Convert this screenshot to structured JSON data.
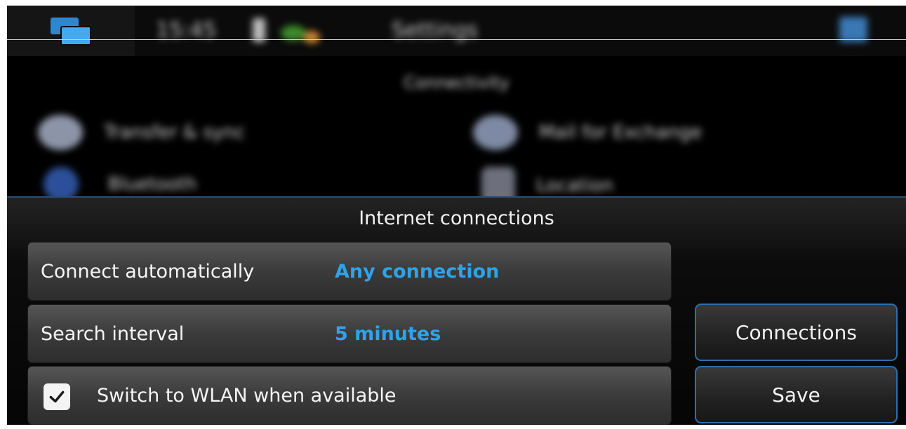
{
  "status_bar": {
    "time": "15:45",
    "title": "Settings",
    "app_switcher_icon": "app-switcher-icon",
    "close_icon": "close-icon"
  },
  "settings_page": {
    "heading": "Connectivity",
    "items": [
      {
        "label": "Transfer & sync",
        "icon": "sync-icon"
      },
      {
        "label": "Mail for Exchange",
        "icon": "mail-icon"
      },
      {
        "label": "Bluetooth",
        "icon": "bluetooth-icon"
      },
      {
        "label": "Location",
        "icon": "location-icon"
      }
    ]
  },
  "dialog": {
    "title": "Internet connections",
    "connect_automatically": {
      "label": "Connect automatically",
      "value": "Any connection"
    },
    "search_interval": {
      "label": "Search interval",
      "value": "5 minutes"
    },
    "wlan_switch": {
      "label": "Switch to WLAN when available",
      "checked": true
    },
    "buttons": {
      "connections": "Connections",
      "save": "Save"
    }
  },
  "colors": {
    "accent_blue": "#2fa3ea",
    "button_border": "#2d6fab",
    "dialog_border": "#2b4d71"
  }
}
